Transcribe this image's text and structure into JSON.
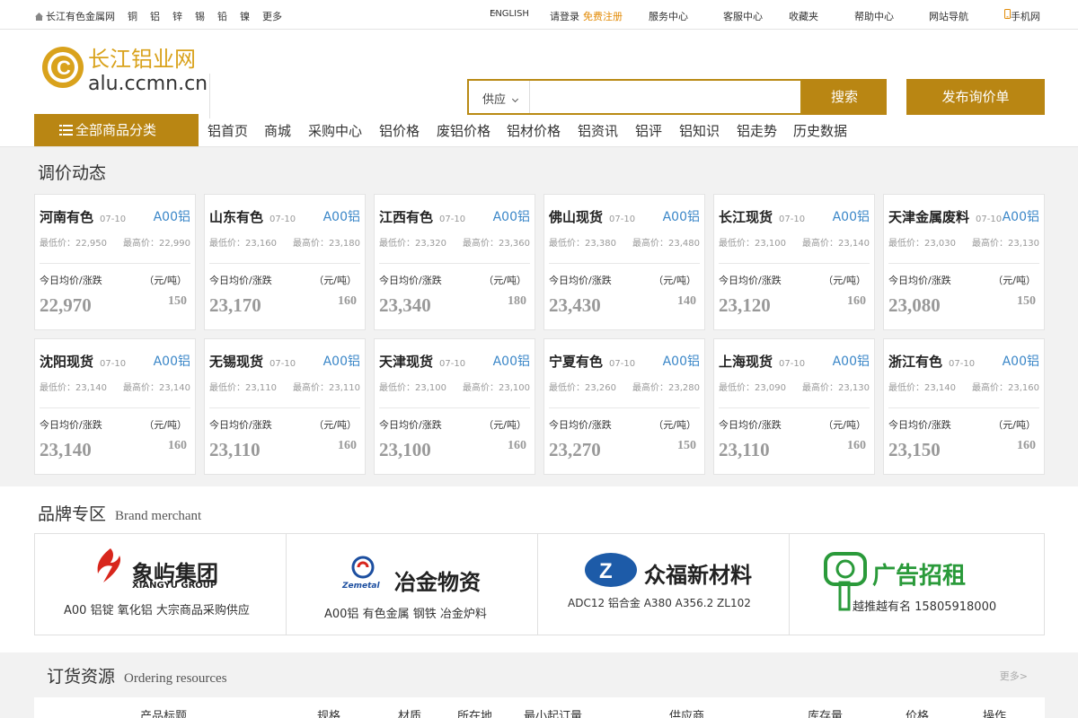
{
  "topbar": {
    "site_name": "长江有色金属网",
    "metals": [
      "铜",
      "铝",
      "锌",
      "锡",
      "铅",
      "镍",
      "更多"
    ],
    "english": "ENGLISH",
    "login": "请登录",
    "register": "免费注册",
    "service": "服务中心",
    "support": "客服中心",
    "favorites": "收藏夹",
    "help": "帮助中心",
    "site_nav": "网站导航",
    "mobile": "手机网"
  },
  "header": {
    "logo_cn": "长江铝业网",
    "logo_en": "alu.ccmn.cn",
    "search_select": "供应",
    "search_placeholder": "",
    "search_button": "搜索",
    "inquiry_button": "发布询价单"
  },
  "nav": {
    "all_categories": "全部商品分类",
    "items": [
      "铝首页",
      "商城",
      "采购中心",
      "铝价格",
      "废铝价格",
      "铝材价格",
      "铝资讯",
      "铝评",
      "铝知识",
      "铝走势",
      "历史数据"
    ]
  },
  "price_section": {
    "title": "调价动态",
    "cards": [
      {
        "name": "河南有色",
        "date": "07-10",
        "tag": "A00铝",
        "low": "最低价：22,950",
        "high": "最高价：22,990",
        "avg_label": "今日均价/涨跌",
        "unit": "（元/吨）",
        "avg": "22,970",
        "change": "150"
      },
      {
        "name": "山东有色",
        "date": "07-10",
        "tag": "A00铝",
        "low": "最低价：23,160",
        "high": "最高价：23,180",
        "avg_label": "今日均价/涨跌",
        "unit": "（元/吨）",
        "avg": "23,170",
        "change": "160"
      },
      {
        "name": "江西有色",
        "date": "07-10",
        "tag": "A00铝",
        "low": "最低价：23,320",
        "high": "最高价：23,360",
        "avg_label": "今日均价/涨跌",
        "unit": "（元/吨）",
        "avg": "23,340",
        "change": "180"
      },
      {
        "name": "佛山现货",
        "date": "07-10",
        "tag": "A00铝",
        "low": "最低价：23,380",
        "high": "最高价：23,480",
        "avg_label": "今日均价/涨跌",
        "unit": "（元/吨）",
        "avg": "23,430",
        "change": "140"
      },
      {
        "name": "长江现货",
        "date": "07-10",
        "tag": "A00铝",
        "low": "最低价：23,100",
        "high": "最高价：23,140",
        "avg_label": "今日均价/涨跌",
        "unit": "（元/吨）",
        "avg": "23,120",
        "change": "160"
      },
      {
        "name": "天津金属废料",
        "date": "07-10",
        "tag": "A00铝",
        "low": "最低价：23,030",
        "high": "最高价：23,130",
        "avg_label": "今日均价/涨跌",
        "unit": "（元/吨）",
        "avg": "23,080",
        "change": "150"
      },
      {
        "name": "沈阳现货",
        "date": "07-10",
        "tag": "A00铝",
        "low": "最低价：23,140",
        "high": "最高价：23,140",
        "avg_label": "今日均价/涨跌",
        "unit": "（元/吨）",
        "avg": "23,140",
        "change": "160"
      },
      {
        "name": "无锡现货",
        "date": "07-10",
        "tag": "A00铝",
        "low": "最低价：23,110",
        "high": "最高价：23,110",
        "avg_label": "今日均价/涨跌",
        "unit": "（元/吨）",
        "avg": "23,110",
        "change": "160"
      },
      {
        "name": "天津现货",
        "date": "07-10",
        "tag": "A00铝",
        "low": "最低价：23,100",
        "high": "最高价：23,100",
        "avg_label": "今日均价/涨跌",
        "unit": "（元/吨）",
        "avg": "23,100",
        "change": "160"
      },
      {
        "name": "宁夏有色",
        "date": "07-10",
        "tag": "A00铝",
        "low": "最低价：23,260",
        "high": "最高价：23,280",
        "avg_label": "今日均价/涨跌",
        "unit": "（元/吨）",
        "avg": "23,270",
        "change": "150"
      },
      {
        "name": "上海现货",
        "date": "07-10",
        "tag": "A00铝",
        "low": "最低价：23,090",
        "high": "最高价：23,130",
        "avg_label": "今日均价/涨跌",
        "unit": "（元/吨）",
        "avg": "23,110",
        "change": "160"
      },
      {
        "name": "浙江有色",
        "date": "07-10",
        "tag": "A00铝",
        "low": "最低价：23,140",
        "high": "最高价：23,160",
        "avg_label": "今日均价/涨跌",
        "unit": "（元/吨）",
        "avg": "23,150",
        "change": "160"
      }
    ]
  },
  "brand_section": {
    "title": "品牌专区",
    "subtitle": "Brand merchant",
    "brands": [
      {
        "name": "象屿集团",
        "name_en": "XIANGYU GROUP",
        "desc": "A00 铝锭   氧化铝 大宗商品采购供应"
      },
      {
        "name": "冶金物资",
        "name_en": "Zemetal",
        "desc": "A00铝  有色金属   钢铁   冶金炉料"
      },
      {
        "name": "众福新材料",
        "name_en": "",
        "desc": "ADC12 铝合金   A380   A356.2   ZL102"
      },
      {
        "name": "广告招租",
        "name_en": "",
        "desc": "越推越有名 15805918000"
      }
    ]
  },
  "order_section": {
    "title": "订货资源",
    "subtitle": "Ordering resources",
    "more": "更多>",
    "columns": [
      "产品标题",
      "规格",
      "材质",
      "所在地",
      "最小起订量",
      "供应商",
      "库存量",
      "价格",
      "操作"
    ]
  },
  "colors": {
    "gold": "#b98613",
    "blue_tag": "#3b87c8",
    "register_orange": "#e28a05"
  }
}
